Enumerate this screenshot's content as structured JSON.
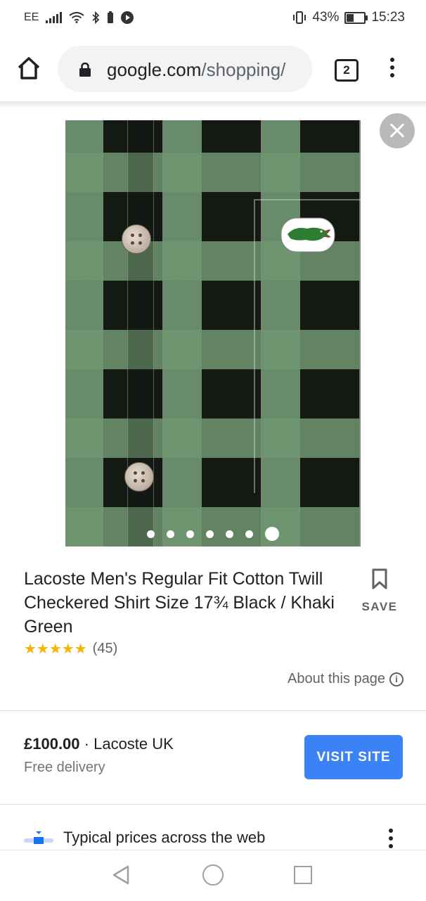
{
  "status_bar": {
    "carrier": "EE",
    "battery_percent": "43%",
    "battery_level": 0.43,
    "time": "15:23"
  },
  "browser": {
    "url_domain": "google.com",
    "url_path": "/shopping/",
    "tab_count": "2"
  },
  "gallery": {
    "image_count": 7,
    "active_index": 6
  },
  "product": {
    "title": "Lacoste Men's Regular Fit Cotton Twill Checkered Shirt Size 17¾ Black / Khaki Green",
    "save_label": "SAVE",
    "stars": "★★★★★",
    "rating": 5,
    "review_count": "(45)",
    "about_label": "About this page"
  },
  "offer": {
    "price": "£100.00",
    "separator": " · ",
    "seller": "Lacoste UK",
    "delivery": "Free delivery",
    "visit_label": "VISIT SITE"
  },
  "typical_prices": {
    "label": "Typical prices across the web"
  },
  "colors": {
    "accent_button": "#3b82f6",
    "star": "#f4b400",
    "shirt_green": "#6f9670",
    "shirt_black": "#141914"
  }
}
